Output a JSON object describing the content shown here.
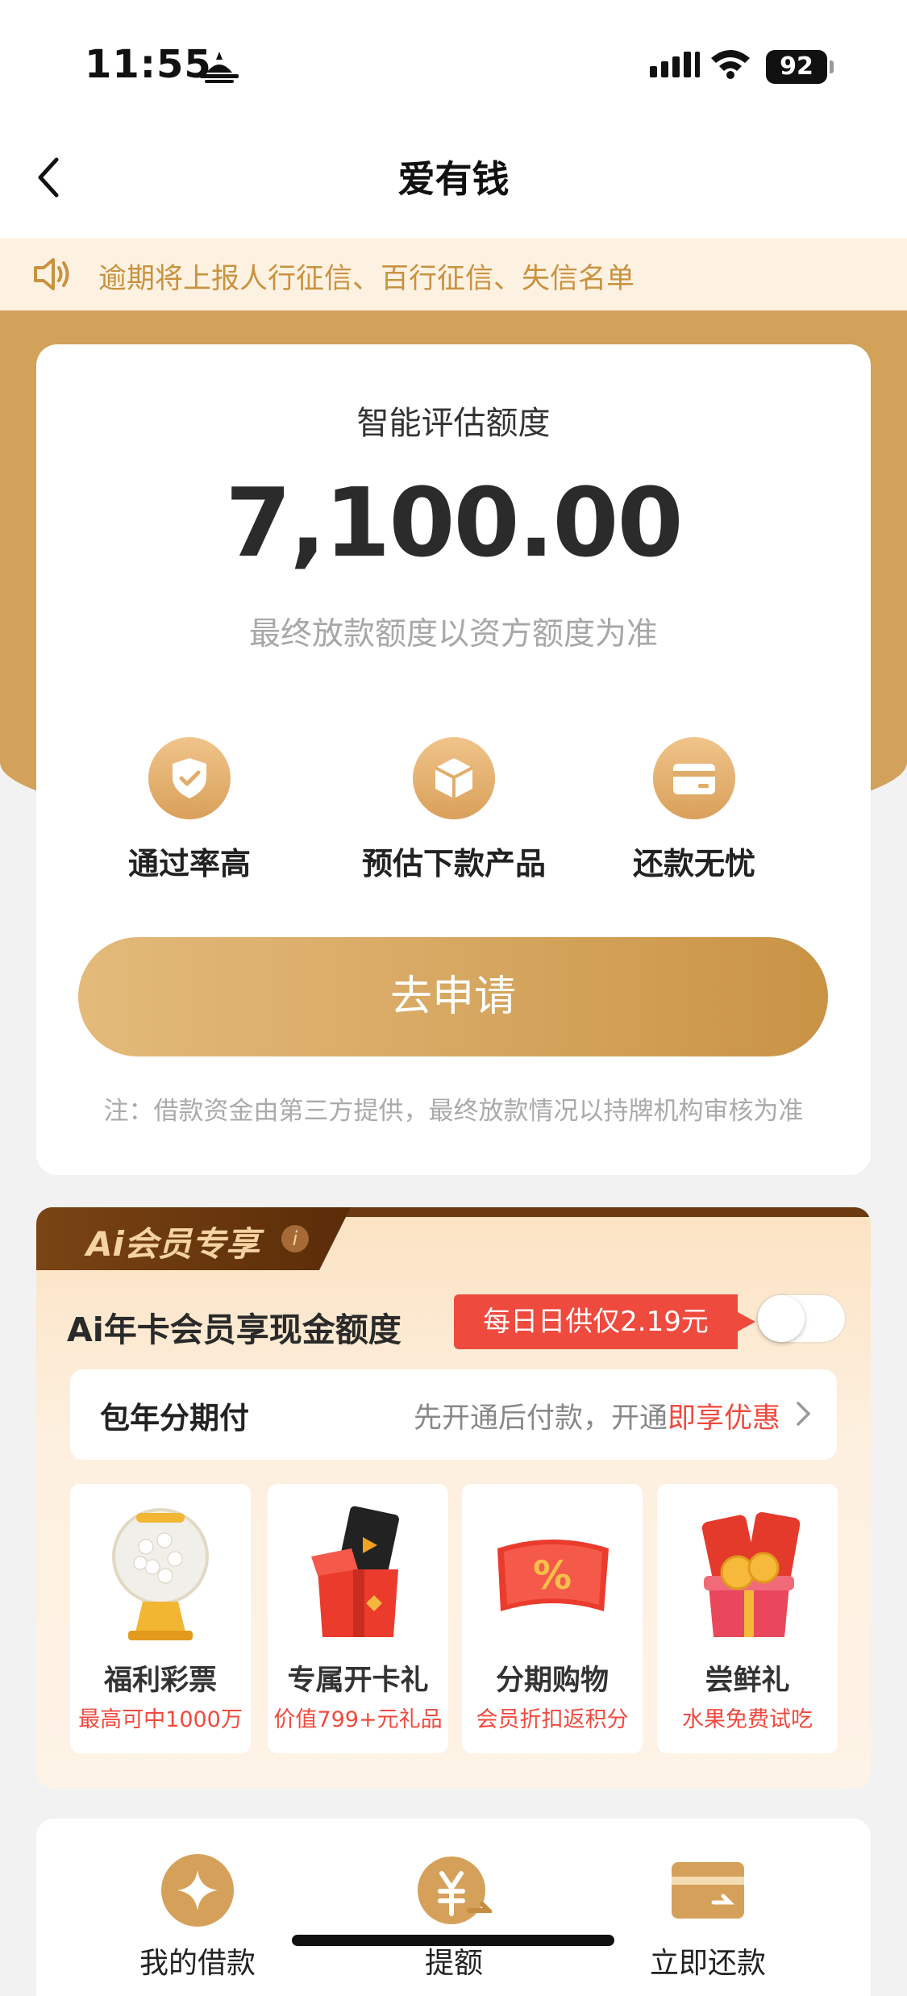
{
  "status_bar": {
    "time": "11:55",
    "battery": "92"
  },
  "nav": {
    "title": "爱有钱"
  },
  "notice": {
    "text": "逾期将上报人行征信、百行征信、失信名单"
  },
  "credit": {
    "label": "智能评估额度",
    "amount": "7,100.00",
    "note": "最终放款额度以资方额度为准",
    "features": [
      {
        "icon": "shield-check-icon",
        "label": "通过率高"
      },
      {
        "icon": "box-icon",
        "label": "预估下款产品"
      },
      {
        "icon": "card-icon",
        "label": "还款无忧"
      }
    ],
    "apply_label": "去申请",
    "disclaimer": "注：借款资金由第三方提供，最终放款情况以持牌机构审核为准"
  },
  "member": {
    "tab_label": "Ai会员专享",
    "info": "i",
    "title": "Ai年卡会员享现金额度",
    "daily_badge": "每日日供仅2.19元",
    "toggle_on": false,
    "pay_row": {
      "title": "包年分期付",
      "desc_prefix": "先开通后付款，开通",
      "desc_highlight": "即享优惠"
    },
    "benefits": [
      {
        "icon": "lottery-icon",
        "name": "福利彩票",
        "sub": "最高可中1000万"
      },
      {
        "icon": "gift-box-icon",
        "name": "专属开卡礼",
        "sub": "价值799+元礼品"
      },
      {
        "icon": "coupon-icon",
        "name": "分期购物",
        "sub": "会员折扣返积分"
      },
      {
        "icon": "red-packet-icon",
        "name": "尝鲜礼",
        "sub": "水果免费试吃"
      }
    ]
  },
  "bottom_tabs": [
    {
      "icon": "star-coin-icon",
      "label": "我的借款"
    },
    {
      "icon": "yuan-coin-icon",
      "label": "提额"
    },
    {
      "icon": "wallet-icon",
      "label": "立即还款"
    }
  ],
  "colors": {
    "gold": "#d2a15a",
    "red": "#ef4a3e",
    "notice_text": "#c9923f"
  }
}
